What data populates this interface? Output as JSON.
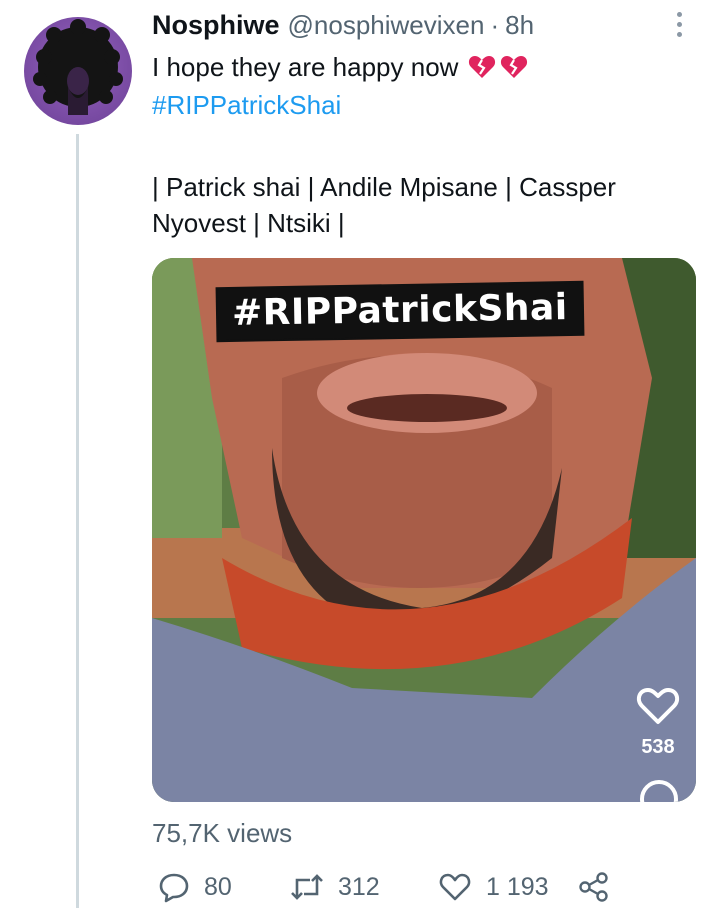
{
  "tweet": {
    "author_name": "Nosphiwe",
    "handle": "@nosphiwevixen",
    "separator": "·",
    "timestamp": "8h",
    "text_line1": "I hope they are happy now",
    "hashtag": "#RIPPatrickShai",
    "text_line3": "| Patrick shai | Andile Mpisane | Cassper",
    "text_line4": "Nyovest | Ntsiki |",
    "emojis": [
      "broken-heart",
      "broken-heart"
    ]
  },
  "media": {
    "overlay_text": "#RIPPatrickShai",
    "like_count": "538"
  },
  "views": "75,7K views",
  "actions": {
    "replies": "80",
    "retweets": "312",
    "likes": "1 193"
  },
  "colors": {
    "link": "#1d9bf0",
    "secondary_text": "#536471",
    "avatar": "#7e4fa8",
    "heart_emoji": "#e0245e"
  }
}
